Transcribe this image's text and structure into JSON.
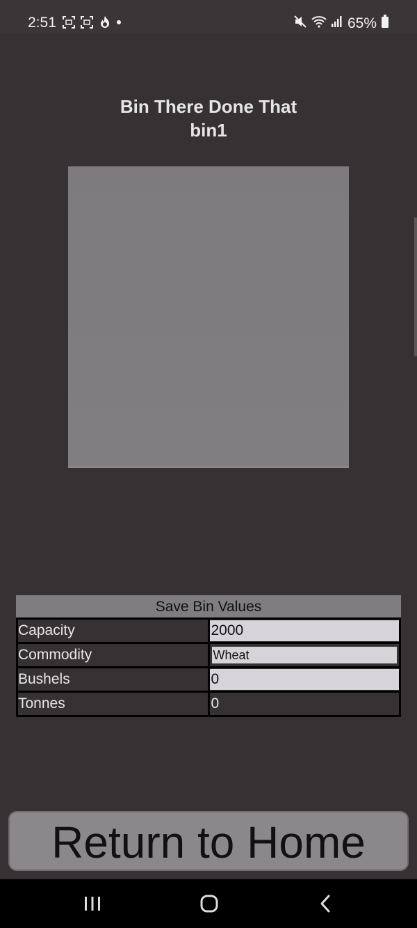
{
  "status_bar": {
    "time": "2:51",
    "battery": "65%",
    "icons": [
      "screenshot-icon",
      "screenshot-icon",
      "flame-app-icon",
      "notification-dot-icon",
      "mute-icon",
      "wifi-icon",
      "signal-icon",
      "battery-icon"
    ]
  },
  "header": {
    "title": "Bin There Done That",
    "subtitle": "bin1"
  },
  "form": {
    "save_label": "Save Bin Values",
    "rows": [
      {
        "label": "Capacity",
        "value": "2000"
      },
      {
        "label": "Commodity",
        "value": "Wheat"
      },
      {
        "label": "Bushels",
        "value": "0"
      },
      {
        "label": "Tonnes",
        "value": "0"
      }
    ]
  },
  "return_label": "Return to Home",
  "colors": {
    "background": "#363233",
    "panel": "#7f7d80",
    "input": "#d6d4d8"
  }
}
